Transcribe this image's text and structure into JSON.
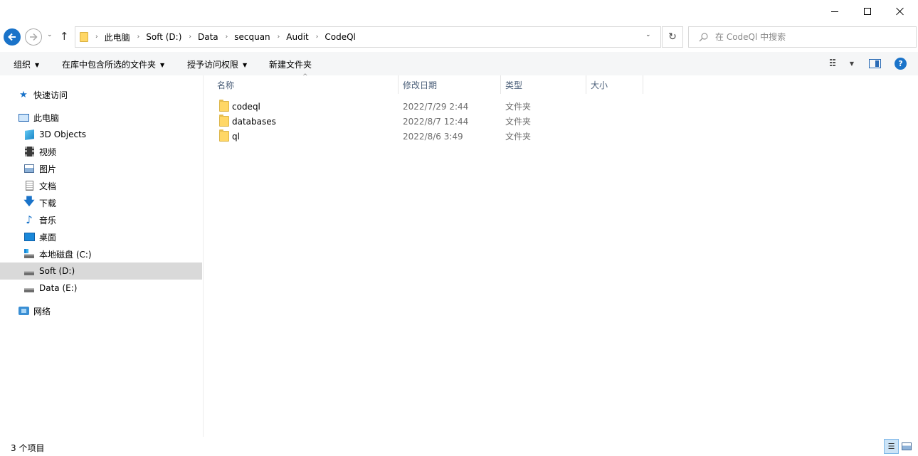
{
  "window": {
    "minimize_glyph": "",
    "maximize_glyph": "",
    "close_glyph": ""
  },
  "nav": {
    "back_icon": "back-arrow-icon",
    "forward_icon": "forward-arrow-icon",
    "recent_glyph": "⌄",
    "up_glyph": "↑"
  },
  "address": {
    "crumbs": [
      "此电脑",
      "Soft (D:)",
      "Data",
      "secquan",
      "Audit",
      "CodeQl"
    ],
    "separator": "›",
    "dropdown_glyph": "⌄",
    "refresh_glyph": "↻"
  },
  "search": {
    "placeholder": "在 CodeQl 中搜索",
    "value": ""
  },
  "toolbar": {
    "organize": "组织",
    "include_in_library": "在库中包含所选的文件夹",
    "share_with": "授予访问权限",
    "new_folder": "新建文件夹",
    "arrow": "▼",
    "help": "?"
  },
  "sidebar": {
    "items": [
      {
        "label": "快速访问",
        "icon": "star-icon"
      },
      {
        "label": "此电脑",
        "icon": "computer-icon"
      },
      {
        "label": "3D Objects",
        "icon": "3d-objects-icon"
      },
      {
        "label": "视频",
        "icon": "video-icon"
      },
      {
        "label": "图片",
        "icon": "picture-icon"
      },
      {
        "label": "文档",
        "icon": "document-icon"
      },
      {
        "label": "下载",
        "icon": "download-icon"
      },
      {
        "label": "音乐",
        "icon": "music-icon"
      },
      {
        "label": "桌面",
        "icon": "desktop-icon"
      },
      {
        "label": "本地磁盘 (C:)",
        "icon": "drive-c-icon"
      },
      {
        "label": "Soft (D:)",
        "icon": "drive-icon"
      },
      {
        "label": "Data (E:)",
        "icon": "drive-icon"
      },
      {
        "label": "网络",
        "icon": "network-icon"
      }
    ],
    "glyphs": {
      "star": "★",
      "down": "🡇",
      "music": "♪"
    }
  },
  "columns": {
    "name": "名称",
    "date": "修改日期",
    "type": "类型",
    "size": "大小",
    "sort_glyph": "^"
  },
  "files": [
    {
      "name": "codeql",
      "date": "2022/7/29 2:44",
      "type": "文件夹"
    },
    {
      "name": "databases",
      "date": "2022/8/7 12:44",
      "type": "文件夹"
    },
    {
      "name": "ql",
      "date": "2022/8/6 3:49",
      "type": "文件夹"
    }
  ],
  "status": {
    "item_count": "3 个项目",
    "details_glyph": "☰"
  },
  "colors": {
    "accent": "#1a73c9",
    "selected_bg": "#d9d9d9",
    "toolbar_bg": "#f5f6f7",
    "folder": "#ffd766"
  }
}
